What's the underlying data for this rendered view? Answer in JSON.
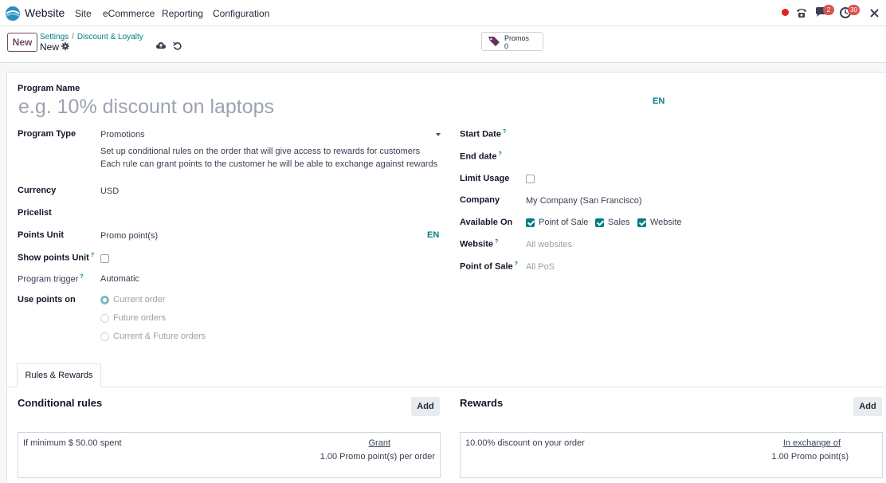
{
  "navbar": {
    "app_name": "Website",
    "menu": [
      "Site",
      "eCommerce",
      "Reporting",
      "Configuration"
    ],
    "messages_count": "2",
    "activities_count": "30",
    "colors": {
      "accent": "#017e84",
      "primary": "#714b67",
      "badge": "#d9534f"
    }
  },
  "control": {
    "new_label": "New",
    "breadcrumb": [
      "Settings",
      "Discount & Loyalty"
    ],
    "record_name": "New",
    "smart_button": {
      "label": "Promos",
      "value": "0"
    }
  },
  "form": {
    "program_name_label": "Program Name",
    "program_name_placeholder": "e.g. 10% discount on laptops",
    "lang_code": "EN",
    "program_type": {
      "label": "Program Type",
      "value": "Promotions",
      "description": [
        "Set up conditional rules on the order that will give access to rewards for customers",
        "Each rule can grant points to the customer he will be able to exchange against rewards"
      ]
    },
    "currency": {
      "label": "Currency",
      "value": "USD"
    },
    "pricelist": {
      "label": "Pricelist",
      "value": ""
    },
    "points_unit": {
      "label": "Points Unit",
      "value": "Promo point(s)"
    },
    "show_points_unit": {
      "label": "Show points Unit",
      "help": "?",
      "checked": false
    },
    "program_trigger": {
      "label": "Program trigger",
      "help": "?",
      "value": "Automatic"
    },
    "use_points_on": {
      "label": "Use points on",
      "options": [
        "Current order",
        "Future orders",
        "Current & Future orders"
      ],
      "selected": 0
    },
    "start_date": {
      "label": "Start Date",
      "help": "?"
    },
    "end_date": {
      "label": "End date",
      "help": "?"
    },
    "limit_usage": {
      "label": "Limit Usage",
      "checked": false
    },
    "company": {
      "label": "Company",
      "value": "My Company (San Francisco)"
    },
    "available_on": {
      "label": "Available On",
      "options": [
        "Point of Sale",
        "Sales",
        "Website"
      ],
      "checked": [
        true,
        true,
        true
      ]
    },
    "website": {
      "label": "Website",
      "help": "?",
      "placeholder": "All websites"
    },
    "point_of_sale": {
      "label": "Point of Sale",
      "help": "?",
      "placeholder": "All PoS"
    }
  },
  "tabs": {
    "active": "Rules & Rewards",
    "rules": {
      "title": "Conditional rules",
      "add_label": "Add",
      "items": [
        {
          "text": "If minimum $ 50.00 spent",
          "link": "Grant",
          "sub": "1.00 Promo point(s) per order"
        }
      ]
    },
    "rewards": {
      "title": "Rewards",
      "add_label": "Add",
      "items": [
        {
          "text": "10.00% discount on your order",
          "link": "In exchange of",
          "sub": "1.00 Promo point(s)"
        }
      ]
    }
  }
}
